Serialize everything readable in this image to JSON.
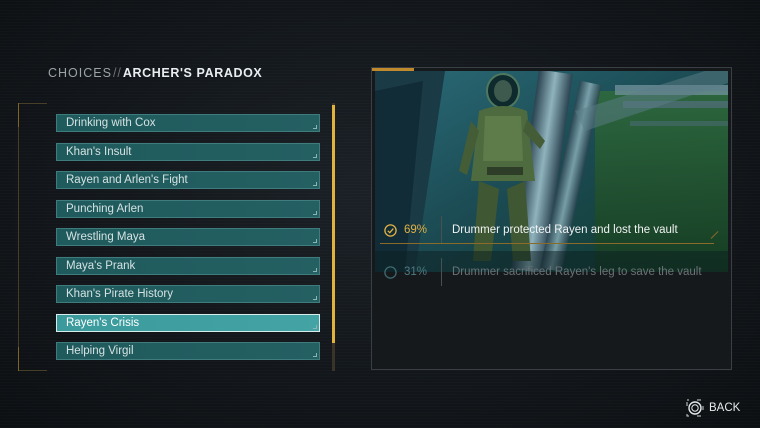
{
  "header": {
    "category": "CHOICES",
    "separator": "//",
    "title": "ARCHER'S PARADOX"
  },
  "choices": [
    {
      "label": "Drinking with Cox"
    },
    {
      "label": "Khan's Insult"
    },
    {
      "label": "Rayen and Arlen's Fight"
    },
    {
      "label": "Punching Arlen"
    },
    {
      "label": "Wrestling Maya"
    },
    {
      "label": "Maya's Prank"
    },
    {
      "label": "Khan's Pirate History"
    },
    {
      "label": "Rayen's Crisis",
      "selected": true
    },
    {
      "label": "Helping Virgil"
    }
  ],
  "scrollbar": {
    "position_fraction": 0.0,
    "visible_fraction": 0.9
  },
  "detail": {
    "outcomes": [
      {
        "percent": "69%",
        "text": "Drummer protected Rayen and lost the vault",
        "chosen": true
      },
      {
        "percent": "31%",
        "text": "Drummer sacrificed Rayen's leg to save the vault",
        "chosen": false
      }
    ]
  },
  "footer": {
    "back_label": "BACK",
    "back_icon": "circle-button-icon"
  },
  "colors": {
    "accent_gold": "#e2b245",
    "teal": "#245f62",
    "teal_selected": "#43a3a5"
  }
}
